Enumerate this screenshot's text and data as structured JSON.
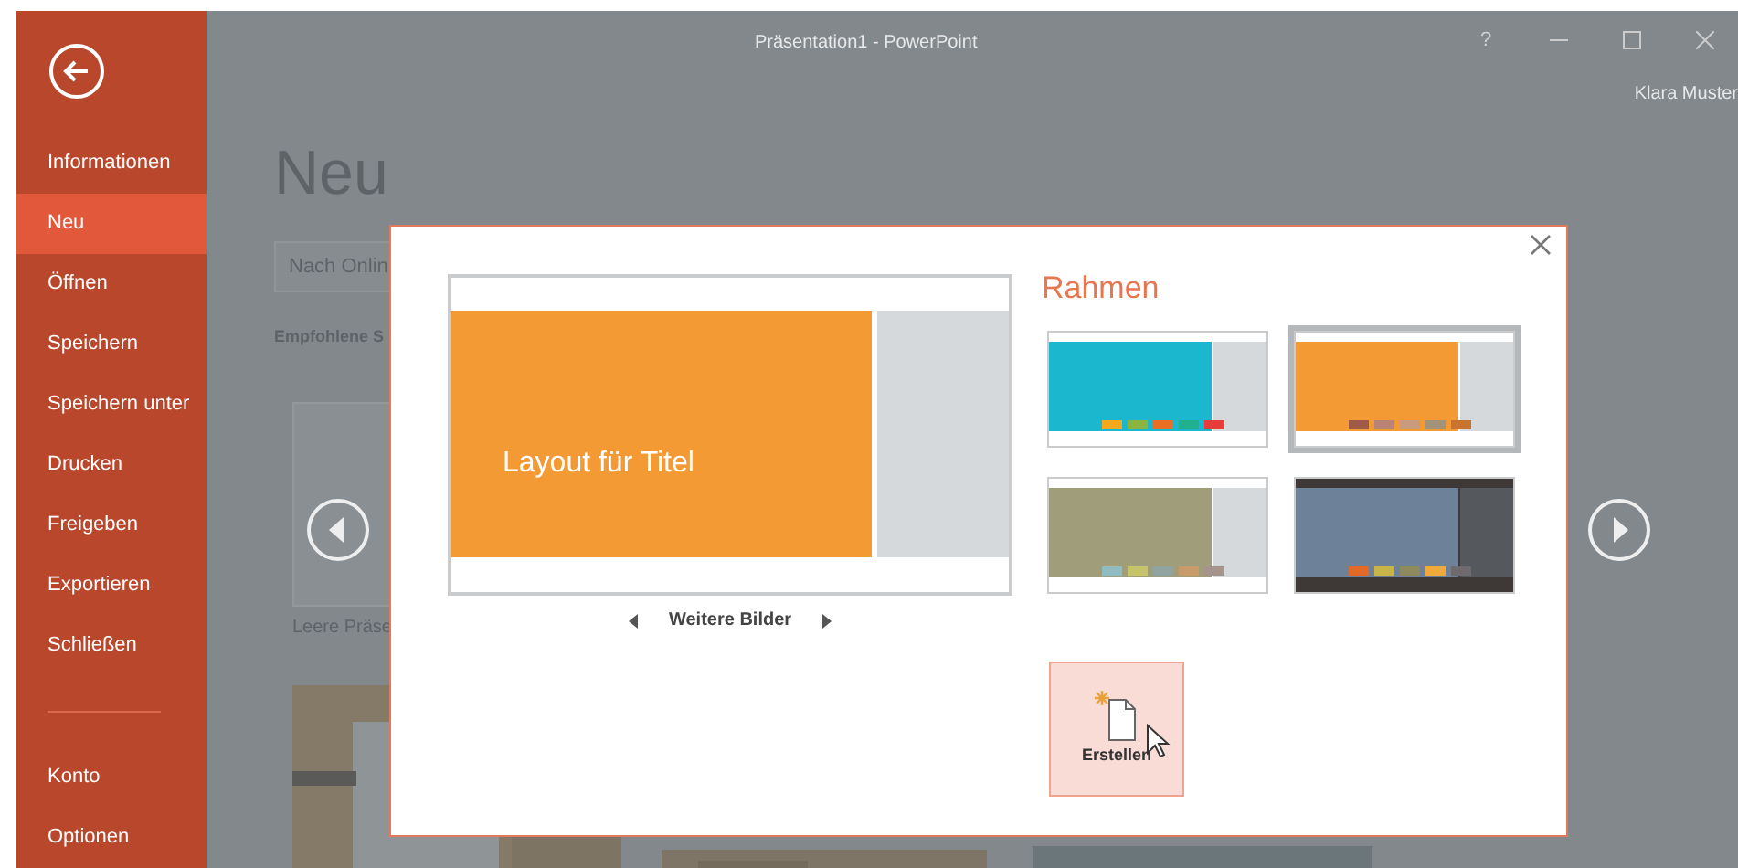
{
  "window": {
    "title": "Präsentation1 - PowerPoint",
    "help": "?",
    "user": "Klara Muster"
  },
  "sidebar": {
    "items": [
      {
        "label": "Informationen",
        "selected": false
      },
      {
        "label": "Neu",
        "selected": true
      },
      {
        "label": "Öffnen",
        "selected": false
      },
      {
        "label": "Speichern",
        "selected": false
      },
      {
        "label": "Speichern unter",
        "selected": false
      },
      {
        "label": "Drucken",
        "selected": false
      },
      {
        "label": "Freigeben",
        "selected": false
      },
      {
        "label": "Exportieren",
        "selected": false
      },
      {
        "label": "Schließen",
        "selected": false
      }
    ],
    "footer_items": [
      {
        "label": "Konto",
        "selected": false
      },
      {
        "label": "Optionen",
        "selected": false
      }
    ]
  },
  "backstage": {
    "heading": "Neu",
    "search": {
      "placeholder": "Nach Onlin"
    },
    "section": "Empfohlene S",
    "template_caption": "Leere Präse"
  },
  "dialog": {
    "preview_title": "Layout für Titel",
    "more_images": "Weitere Bilder",
    "variants_title": "Rahmen",
    "variants": [
      {
        "kind": "light",
        "color": "#1ab7cf",
        "selected": false,
        "swatches": [
          {
            "color": "#f4a81c"
          },
          {
            "color": "#8ab43f"
          },
          {
            "color": "#e96f25"
          },
          {
            "color": "#20b08e"
          },
          {
            "color": "#e63c3c"
          }
        ]
      },
      {
        "kind": "light",
        "color": "#f39a35",
        "selected": true,
        "swatches": [
          {
            "color": "#a05a48"
          },
          {
            "color": "#b98477"
          },
          {
            "color": "#c89a7e"
          },
          {
            "color": "#a2927a"
          },
          {
            "color": "#c8742f"
          }
        ]
      },
      {
        "kind": "light",
        "color": "#a09d7a",
        "selected": false,
        "swatches": [
          {
            "color": "#8fbcc0"
          },
          {
            "color": "#c6c46a"
          },
          {
            "color": "#8fa3a0"
          },
          {
            "color": "#c99a6a"
          },
          {
            "color": "#a3958c"
          }
        ]
      },
      {
        "kind": "dark",
        "color": "#6d8299",
        "selected": false,
        "swatches": [
          {
            "color": "#e16a28"
          },
          {
            "color": "#c9b447"
          },
          {
            "color": "#8f8a5e"
          },
          {
            "color": "#f0a93b"
          },
          {
            "color": "#6e6a6e"
          }
        ]
      }
    ],
    "create_button": "Erstellen"
  }
}
